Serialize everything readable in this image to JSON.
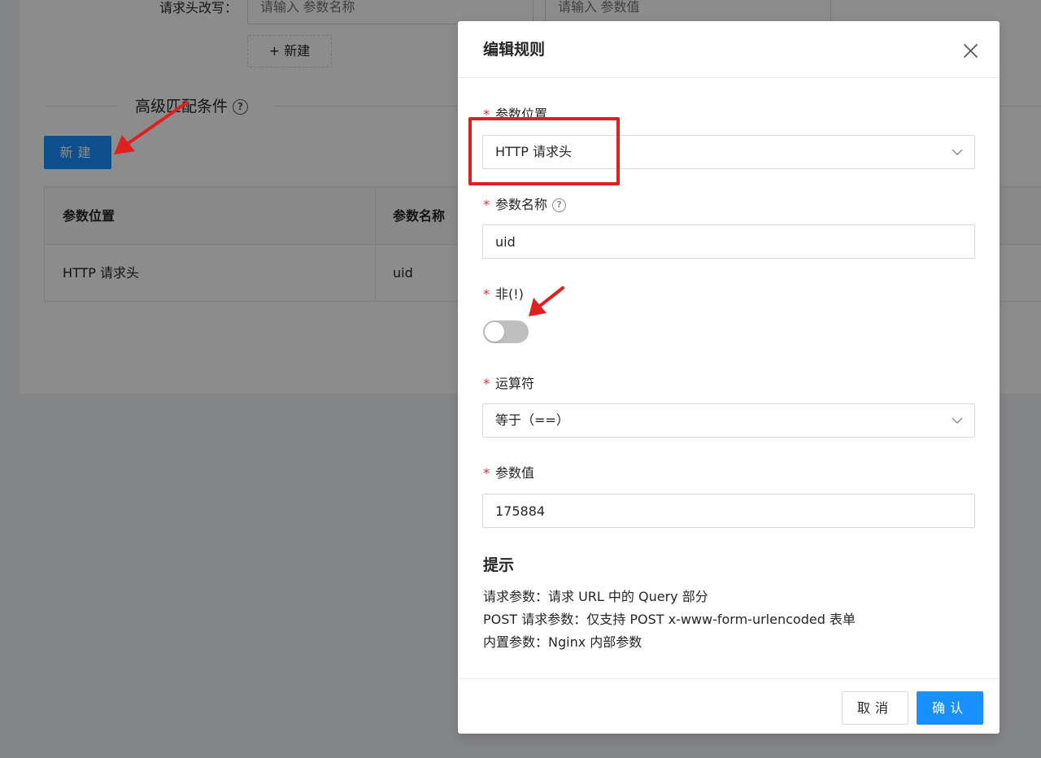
{
  "background": {
    "header_rewrite_label": "请求头改写：",
    "param_name_placeholder": "请输入 参数名称",
    "param_value_placeholder": "请输入 参数值",
    "add_dashed_button": "+ 新建",
    "advanced_section_title": "高级匹配条件",
    "add_button": "新建",
    "table": {
      "headers": [
        "参数位置",
        "参数名称"
      ],
      "rows": [
        [
          "HTTP 请求头",
          "uid"
        ]
      ]
    }
  },
  "modal": {
    "title": "编辑规则",
    "fields": {
      "location": {
        "label": "参数位置",
        "value": "HTTP 请求头"
      },
      "name": {
        "label": "参数名称",
        "value": "uid"
      },
      "negate": {
        "label": "非(!)",
        "checked": false
      },
      "operator": {
        "label": "运算符",
        "value": "等于（==）"
      },
      "value": {
        "label": "参数值",
        "value": "175884"
      }
    },
    "hint": {
      "title": "提示",
      "lines": [
        "请求参数：请求 URL 中的 Query 部分",
        "POST 请求参数：仅支持 POST x-www-form-urlencoded 表单",
        "内置参数：Nginx 内部参数"
      ]
    },
    "buttons": {
      "cancel": "取消",
      "ok": "确认"
    }
  },
  "colors": {
    "primary": "#1890ff",
    "required": "#f5222d",
    "annotation": "#e02020",
    "toggle_off": "#bfbfbf"
  },
  "icons": {
    "close": "close-icon",
    "chevron": "chevron-down-icon",
    "help": "question-circle-icon"
  }
}
